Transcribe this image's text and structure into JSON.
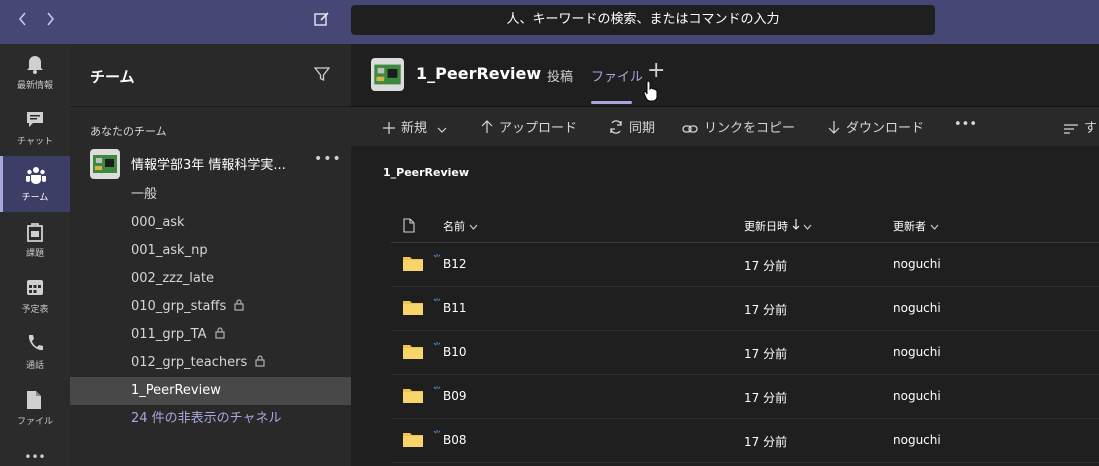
{
  "topbar": {
    "back_icon": "chevron-left-icon",
    "forward_icon": "chevron-right-icon",
    "compose_icon": "compose-icon",
    "search_placeholder": "人、キーワードの検索、またはコマンドの入力"
  },
  "rail": {
    "items": [
      {
        "label": "最新情報",
        "icon": "bell-icon"
      },
      {
        "label": "チャット",
        "icon": "chat-icon"
      },
      {
        "label": "チーム",
        "icon": "teams-icon",
        "active": true
      },
      {
        "label": "課題",
        "icon": "assignments-icon"
      },
      {
        "label": "予定表",
        "icon": "calendar-icon"
      },
      {
        "label": "通話",
        "icon": "phone-icon"
      },
      {
        "label": "ファイル",
        "icon": "file-icon"
      }
    ],
    "more": "•••"
  },
  "team_panel": {
    "title": "チーム",
    "section_label": "あなたのチーム",
    "team_name": "情報学部3年 情報科学実...",
    "team_more": "•••",
    "channels": [
      {
        "label": "一般",
        "locked": false
      },
      {
        "label": "000_ask",
        "locked": false
      },
      {
        "label": "001_ask_np",
        "locked": false
      },
      {
        "label": "002_zzz_late",
        "locked": false
      },
      {
        "label": "010_grp_staffs",
        "locked": true
      },
      {
        "label": "011_grp_TA",
        "locked": true
      },
      {
        "label": "012_grp_teachers",
        "locked": true
      },
      {
        "label": "1_PeerReview",
        "locked": false,
        "active": true
      }
    ],
    "hidden_channels": "24 件の非表示のチャネル"
  },
  "header": {
    "channel_title": "1_PeerReview",
    "tabs": [
      {
        "label": "投稿"
      },
      {
        "label": "ファイル",
        "active": true
      }
    ],
    "add_tab": "+"
  },
  "toolbar": {
    "new": "新規",
    "upload": "アップロード",
    "sync": "同期",
    "copy_link": "リンクをコピー",
    "download": "ダウンロード",
    "more": "•••",
    "sort_partial": "す"
  },
  "files": {
    "path": "1_PeerReview",
    "columns": {
      "name": "名前",
      "modified": "更新日時",
      "modified_by": "更新者"
    },
    "rows": [
      {
        "name": "B12",
        "modified": "17 分前",
        "modified_by": "noguchi"
      },
      {
        "name": "B11",
        "modified": "17 分前",
        "modified_by": "noguchi"
      },
      {
        "name": "B10",
        "modified": "17 分前",
        "modified_by": "noguchi"
      },
      {
        "name": "B09",
        "modified": "17 分前",
        "modified_by": "noguchi"
      },
      {
        "name": "B08",
        "modified": "17 分前",
        "modified_by": "noguchi"
      }
    ]
  },
  "colors": {
    "topbar": "#464775",
    "accent": "#a6a7dc",
    "folder": "#f0c24b"
  }
}
